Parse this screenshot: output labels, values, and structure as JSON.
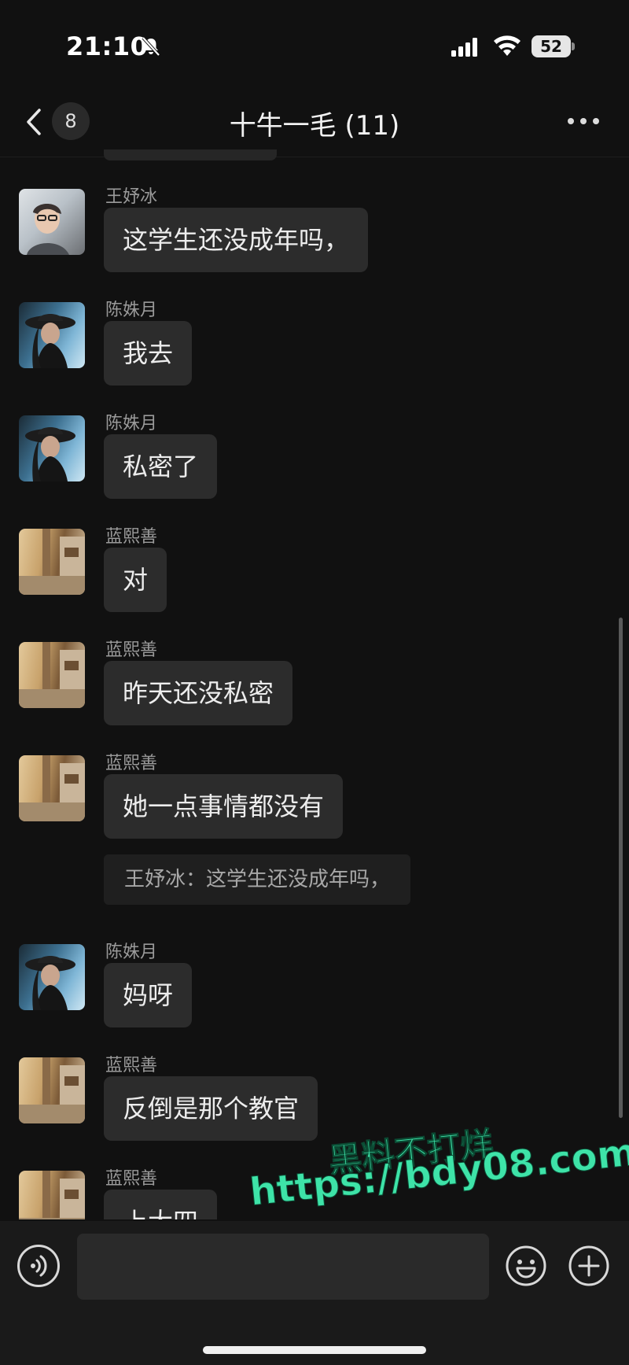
{
  "status_bar": {
    "time": "21:10",
    "battery": "52"
  },
  "nav": {
    "unread_count": "8",
    "title": "十牛一毛 (11)"
  },
  "messages": [
    {
      "sender": "王妤冰",
      "text": "这学生还没成年吗，",
      "avatar": "wang"
    },
    {
      "sender": "陈姝月",
      "text": "我去",
      "avatar": "chen"
    },
    {
      "sender": "陈姝月",
      "text": "私密了",
      "avatar": "chen"
    },
    {
      "sender": "蓝熙善",
      "text": "对",
      "avatar": "lan"
    },
    {
      "sender": "蓝熙善",
      "text": "昨天还没私密",
      "avatar": "lan"
    },
    {
      "sender": "蓝熙善",
      "text": "她一点事情都没有",
      "avatar": "lan",
      "quote": "王妤冰：这学生还没成年吗，"
    },
    {
      "sender": "陈姝月",
      "text": "妈呀",
      "avatar": "chen"
    },
    {
      "sender": "蓝熙善",
      "text": "反倒是那个教官",
      "avatar": "lan"
    },
    {
      "sender": "蓝熙善",
      "text": "上大四",
      "avatar": "lan"
    }
  ],
  "input": {
    "placeholder": ""
  },
  "watermark": {
    "line1": "黑料不打烊",
    "line2": "https://bdy08.com"
  },
  "colors": {
    "background": "#111111",
    "bubble": "#2c2c2c",
    "watermark": "#3ee3a8"
  }
}
